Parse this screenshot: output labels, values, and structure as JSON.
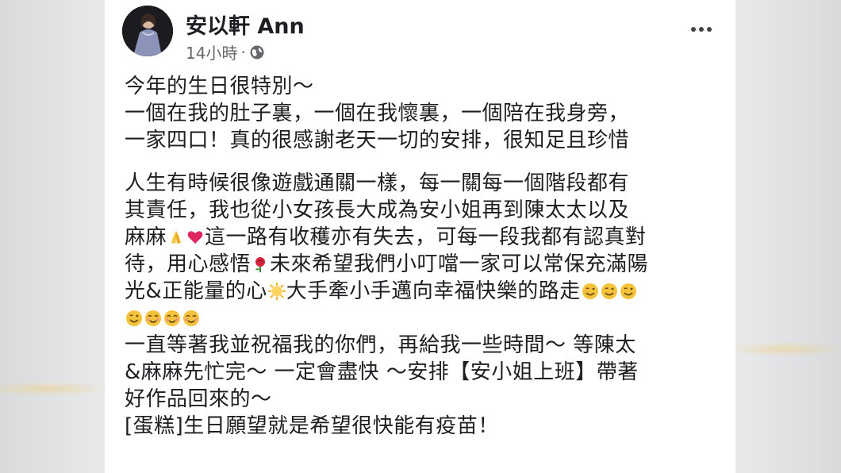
{
  "post": {
    "author": "安以軒 Ann",
    "time": "14小時",
    "separator": "·",
    "paragraph1": [
      "今年的生日很特別～",
      "一個在我的肚子裏，一個在我懷裏，一個陪在我身旁，",
      "一家四口！真的很感謝老天一切的安排，很知足且珍惜"
    ],
    "p2": {
      "l1": "人生有時候很像遊戲通關一樣，每一關每一個階段都有",
      "l2": "其責任，我也從小女孩長大成為安小姐再到陳太太以及",
      "l3a": "麻麻",
      "l3b": "這一路有收穫亦有失去，可每一段我都有認真對",
      "l4a": "待，用心感悟",
      "l4b": "未來希望我們小叮噹一家可以常保充滿陽",
      "l5a": "光&正能量的心",
      "l5b": "大手牽小手邁向幸福快樂的路走",
      "l7": "一直等著我並祝福我的你們，再給我一些時間～ 等陳太",
      "l8": "&麻麻先忙完～ 一定會盡快 ～安排【安小姐上班】帶著",
      "l9": "好作品回來的～",
      "l10": "[蛋糕]生日願望就是希望很快能有疫苗！"
    },
    "icons": {
      "more": "more-options-icon",
      "audience": "globe-icon",
      "pray": "folded-hands-emoji",
      "heart": "red-heart-emoji",
      "rose": "rose-emoji",
      "sun": "sun-with-face-emoji",
      "wink": "winking-face-emoji",
      "smile": "smiling-face-emoji"
    },
    "colors": {
      "text": "#1c1e21",
      "meta": "#65676b",
      "heart": "#e0245e",
      "emoji": "#f5c33b"
    }
  }
}
